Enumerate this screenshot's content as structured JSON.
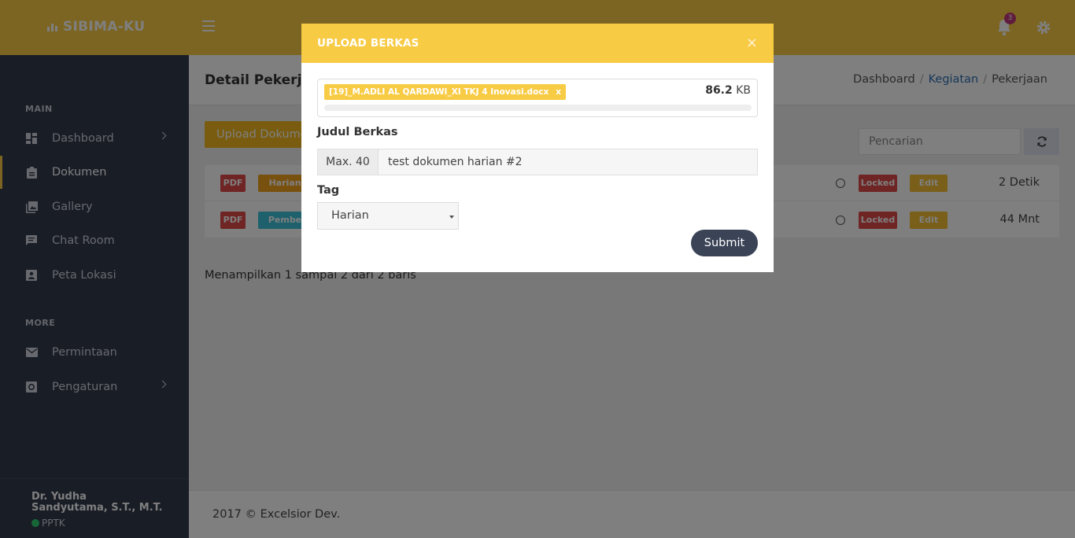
{
  "app": {
    "brand": "SIBIMA-KU",
    "notification_count": "3"
  },
  "sidebar": {
    "section_main": "MAIN",
    "section_more": "MORE",
    "items": [
      {
        "label": "Dashboard",
        "icon": "dashboard-icon"
      },
      {
        "label": "Dokumen",
        "icon": "clipboard-icon"
      },
      {
        "label": "Gallery",
        "icon": "gallery-icon"
      },
      {
        "label": "Chat Room",
        "icon": "chat-icon"
      },
      {
        "label": "Peta Lokasi",
        "icon": "map-icon"
      },
      {
        "label": "Permintaan",
        "icon": "mail-icon"
      },
      {
        "label": "Pengaturan",
        "icon": "settings-icon"
      }
    ],
    "user": {
      "name": "Dr. Yudha Sandyutama, S.T., M.T.",
      "role": "PPTK"
    }
  },
  "page": {
    "title": "Detail Pekerjaan",
    "breadcrumb": [
      "Dashboard",
      "Kegiatan",
      "Pekerjaan"
    ],
    "upload_button": "Upload Dokumen",
    "search_placeholder": "Pencarian",
    "rows": [
      {
        "type": "PDF",
        "tag": "Harian",
        "tag_color": "#f0a21e",
        "status": "Locked",
        "edit": "Edit",
        "time": "2 Detik"
      },
      {
        "type": "PDF",
        "tag": "Pembe",
        "tag_color": "#3dc3d9",
        "status": "Locked",
        "edit": "Edit",
        "time": "44 Mnt"
      }
    ],
    "showing_text": "Menampilkan 1 sampai 2 dari 2 baris",
    "footer": "2017 © Excelsior Dev."
  },
  "modal": {
    "title": "UPLOAD BERKAS",
    "close": "×",
    "file": {
      "name": "[19]_M.ADLI AL QARDAWI_XI TKJ 4 Inovasi.docx",
      "remove": "x",
      "size_value": "86.2",
      "size_unit": "KB",
      "progress": 0
    },
    "judul_label": "Judul Berkas",
    "judul_addon": "Max. 40",
    "judul_value": "test dokumen harian #2",
    "tag_label": "Tag",
    "tag_value": "Harian",
    "submit": "Submit"
  },
  "colors": {
    "topbar": "#f8cb45",
    "sidebar": "#333a4d",
    "danger": "#e14b4b",
    "warning": "#f2b81f"
  }
}
